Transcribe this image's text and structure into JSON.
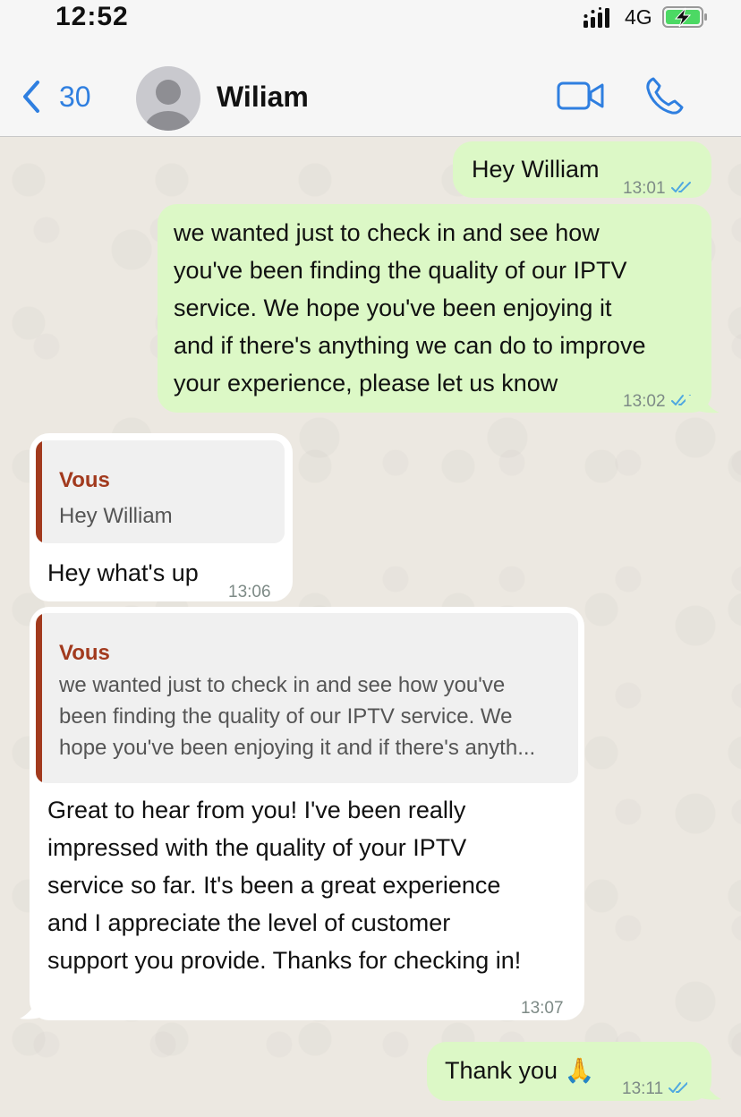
{
  "status_bar": {
    "time": "12:52",
    "network": "4G"
  },
  "header": {
    "back_count": "30",
    "contact_name": "Wiliam"
  },
  "colors": {
    "accent": "#2f7fe0",
    "outgoing_bubble": "#dcf8c6",
    "incoming_bubble": "#ffffff",
    "quote_author": "#a23a1e",
    "ticks": "#4fa8e0"
  },
  "icons": [
    "signal-icon",
    "battery-charging-icon",
    "back-chevron-icon",
    "avatar-icon",
    "video-call-icon",
    "phone-icon",
    "double-check-icon"
  ],
  "messages": [
    {
      "direction": "outgoing",
      "text": "Hey William",
      "time": "13:01",
      "status": "read"
    },
    {
      "direction": "outgoing",
      "lines": [
        "we wanted just to check in and see how",
        "you've been finding the quality of our IPTV",
        "service. We hope you've been enjoying it",
        "and if there's anything we can do to improve",
        "your experience, please let us know"
      ],
      "time": "13:02",
      "status": "read"
    },
    {
      "direction": "incoming",
      "quote": {
        "author": "Vous",
        "text": "Hey William"
      },
      "text": "Hey what's up",
      "time": "13:06"
    },
    {
      "direction": "incoming",
      "quote": {
        "author": "Vous",
        "lines": [
          "we wanted just to check in and see how you've",
          "been finding the quality of our IPTV service. We",
          "hope you've been enjoying it and if there's anyth..."
        ]
      },
      "lines": [
        "Great to hear from you! I've been really",
        "impressed with the quality of your IPTV",
        "service so far. It's been a great experience",
        "and I appreciate the level of customer",
        "support you provide. Thanks for checking in!"
      ],
      "time": "13:07"
    },
    {
      "direction": "outgoing",
      "text": "Thank you 🙏",
      "time": "13:11",
      "status": "read"
    }
  ]
}
